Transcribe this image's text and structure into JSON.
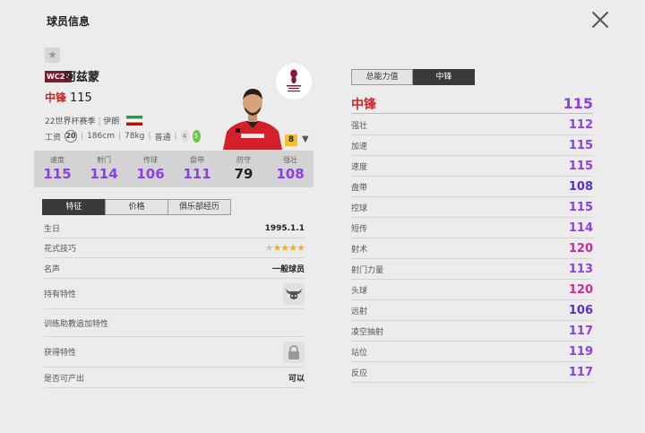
{
  "header": {
    "title": "球员信息"
  },
  "player": {
    "season_badge": "WC22",
    "name": "阿兹蒙",
    "position": "中锋",
    "overall": "115",
    "season": "22世界杯赛季",
    "nation": "伊朗",
    "wage_label": "工资",
    "wage": "20",
    "height": "186cm",
    "weight": "78kg",
    "body_type": "普通",
    "weak_foot": "4",
    "strong_foot": "5",
    "level": "8"
  },
  "stats": [
    {
      "label": "速度",
      "value": "115"
    },
    {
      "label": "射门",
      "value": "114"
    },
    {
      "label": "传球",
      "value": "106"
    },
    {
      "label": "盘带",
      "value": "111"
    },
    {
      "label": "防守",
      "value": "79"
    },
    {
      "label": "强壮",
      "value": "108"
    }
  ],
  "tabs": [
    {
      "label": "特征"
    },
    {
      "label": "价格"
    },
    {
      "label": "俱乐部经历"
    }
  ],
  "details": {
    "birthday_label": "生日",
    "birthday": "1995.1.1",
    "skill_label": "花式技巧",
    "skill_stars": 4,
    "reputation_label": "名声",
    "reputation": "一般球员",
    "traits_label": "持有特性",
    "training_label": "训练助教追加特性",
    "acquired_label": "获得特性",
    "produce_label": "是否可产出",
    "produce": "可以"
  },
  "right_tabs": [
    {
      "label": "总能力值"
    },
    {
      "label": "中锋"
    }
  ],
  "attributes_head": {
    "label": "中锋",
    "value": "115"
  },
  "attributes": [
    {
      "label": "强壮",
      "value": "112",
      "color": "#8e3fe3"
    },
    {
      "label": "加速",
      "value": "115",
      "color": "#8e3fe3"
    },
    {
      "label": "速度",
      "value": "115",
      "color": "#8e3fe3"
    },
    {
      "label": "盘带",
      "value": "108",
      "color": "#5b2fc9"
    },
    {
      "label": "控球",
      "value": "115",
      "color": "#8e3fe3"
    },
    {
      "label": "短传",
      "value": "114",
      "color": "#8e3fe3"
    },
    {
      "label": "射术",
      "value": "120",
      "color": "#d12aa0"
    },
    {
      "label": "射门力量",
      "value": "113",
      "color": "#8e3fe3"
    },
    {
      "label": "头球",
      "value": "120",
      "color": "#d12aa0"
    },
    {
      "label": "远射",
      "value": "106",
      "color": "#5b2fc9"
    },
    {
      "label": "凌空抽射",
      "value": "117",
      "color": "#8e3fe3"
    },
    {
      "label": "站位",
      "value": "119",
      "color": "#8e3fe3"
    },
    {
      "label": "反应",
      "value": "117",
      "color": "#8e3fe3"
    }
  ]
}
